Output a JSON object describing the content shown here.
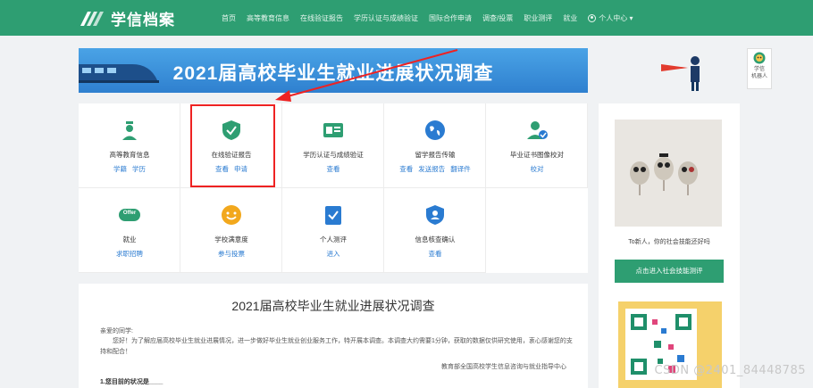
{
  "brand": {
    "name": "学信档案"
  },
  "nav": {
    "items": [
      "首页",
      "高等教育信息",
      "在线验证报告",
      "学历认证与成绩验证",
      "国际合作申请",
      "调查/投票",
      "职业测评",
      "就业"
    ],
    "user_menu": "个人中心 ▾"
  },
  "banner": {
    "title": "2021届高校毕业生就业进展状况调查"
  },
  "robot": {
    "label_line1": "学信",
    "label_line2": "机器人"
  },
  "services": [
    {
      "title": "高等教育信息",
      "links": [
        "学籍",
        "学历"
      ],
      "icon": "graduate-icon",
      "color": "#2e9e72"
    },
    {
      "title": "在线验证报告",
      "links": [
        "查看",
        "申请"
      ],
      "icon": "shield-check-icon",
      "color": "#2e9e72"
    },
    {
      "title": "学历认证与成绩验证",
      "links": [
        "查看"
      ],
      "icon": "certificate-card-icon",
      "color": "#2e9e72"
    },
    {
      "title": "留学报告传输",
      "links": [
        "查看",
        "发送报告",
        "翻译件"
      ],
      "icon": "globe-icon",
      "color": "#2a7bd1"
    },
    {
      "title": "毕业证书图像校对",
      "links": [
        "校对"
      ],
      "icon": "user-check-icon",
      "color": "#2e9e72"
    },
    {
      "title": "就业",
      "links": [
        "求职招聘"
      ],
      "icon": "offer-badge-icon",
      "color": "#2e9e72",
      "badge": "Offer"
    },
    {
      "title": "学校满意度",
      "links": [
        "参与投票"
      ],
      "icon": "smile-icon",
      "color": "#f2a81d"
    },
    {
      "title": "个人测评",
      "links": [
        "进入"
      ],
      "icon": "checklist-icon",
      "color": "#2a7bd1"
    },
    {
      "title": "信息核查确认",
      "links": [
        "查看"
      ],
      "icon": "shield-user-icon",
      "color": "#2a7bd1"
    }
  ],
  "survey": {
    "title": "2021届高校毕业生就业进展状况调查",
    "greeting": "亲爱的同学:",
    "paragraph": "您好！为了解应届高校毕业生就业进展情况，进一步做好毕业生就业创业服务工作，特开展本调查。本调查大约需要1分钟，获取的数据仅供研究使用，衷心感谢您的支持和配合！",
    "signature": "教育部全国高校学生信息咨询与就业指导中心",
    "question": "1.您目前的状况是____"
  },
  "side": {
    "caption": "To新人，你的社会技能还好吗",
    "button": "点击进入社会技能测评"
  },
  "watermark": "CSDN @2401_84448785"
}
